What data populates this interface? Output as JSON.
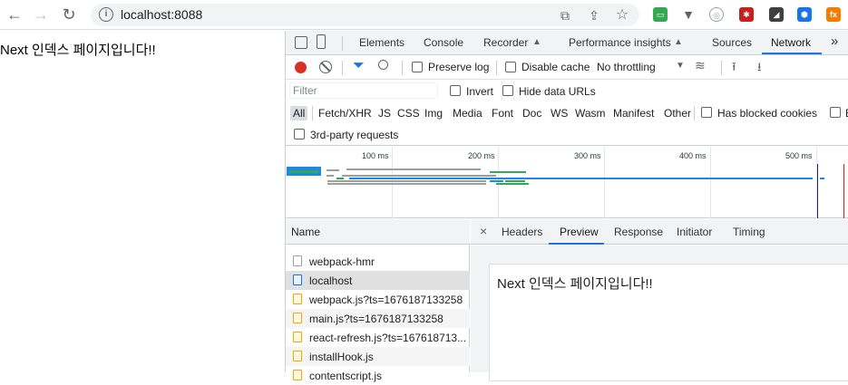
{
  "browser": {
    "url": "localhost:8088",
    "back_icon": "back-arrow-icon",
    "forward_icon": "forward-arrow-icon",
    "reload_icon": "reload-icon"
  },
  "page": {
    "text": "Next 인덱스 페이지입니다!!"
  },
  "devtools": {
    "tabs": [
      "Elements",
      "Console",
      "Recorder",
      "Performance insights",
      "Sources",
      "Network"
    ],
    "active_tab": "Network",
    "more": "»",
    "toolbar": {
      "preserve_log": "Preserve log",
      "disable_cache": "Disable cache",
      "throttling": "No throttling"
    },
    "filter": {
      "placeholder": "Filter",
      "invert": "Invert",
      "hide_data_urls": "Hide data URLs"
    },
    "types": [
      "All",
      "Fetch/XHR",
      "JS",
      "CSS",
      "Img",
      "Media",
      "Font",
      "Doc",
      "WS",
      "Wasm",
      "Manifest",
      "Other"
    ],
    "has_blocked_cookies": "Has blocked cookies",
    "blocked_trunc": "B",
    "third_party": "3rd-party requests",
    "overview_ticks": [
      "100 ms",
      "200 ms",
      "300 ms",
      "400 ms",
      "500 ms"
    ],
    "requests_header": "Name",
    "requests": [
      {
        "name": "webpack-hmr",
        "type": "other"
      },
      {
        "name": "localhost",
        "type": "doc"
      },
      {
        "name": "webpack.js?ts=1676187133258",
        "type": "js"
      },
      {
        "name": "main.js?ts=1676187133258",
        "type": "js"
      },
      {
        "name": "react-refresh.js?ts=167618713...",
        "type": "js"
      },
      {
        "name": "installHook.js",
        "type": "js"
      },
      {
        "name": "contentscript.js",
        "type": "js"
      }
    ],
    "detail_tabs": [
      "Headers",
      "Preview",
      "Response",
      "Initiator",
      "Timing"
    ],
    "active_detail_tab": "Preview",
    "preview_text": "Next 인덱스 페이지입니다!!"
  },
  "colors": {
    "accent": "#1a73e8",
    "record": "#d93025"
  }
}
